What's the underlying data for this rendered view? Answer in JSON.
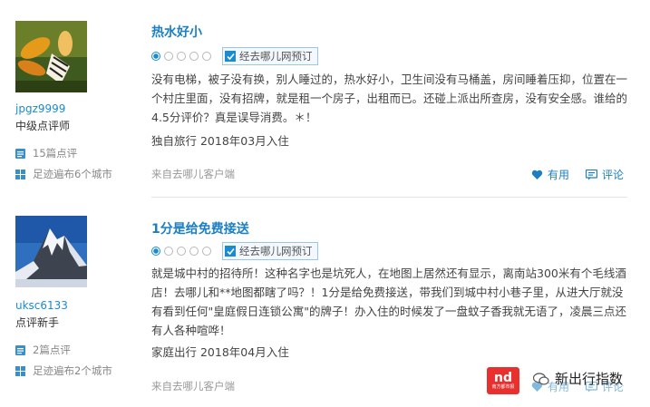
{
  "reviews": [
    {
      "user": {
        "name": "jpgz9999",
        "level": "中级点评师",
        "review_count": "15篇点评",
        "footprint": "足迹遍布6个城市"
      },
      "title": "热水好小",
      "rating": 1,
      "max_rating": 5,
      "verified": "经去哪儿网预订",
      "content": "没有电梯，被子没有换，别人睡过的，热水好小，卫生间没有马桶盖，房间睡着压抑，位置在一个村庄里面，没有招牌，就是租一个房子，出租而已。还碰上派出所查房，没有安全感。谁给的4.5分评价？真是误导消费。＊！",
      "travel": "独自旅行  2018年03月入住",
      "source": "来自去哪儿客户端",
      "useful_label": "有用",
      "comment_label": "评论"
    },
    {
      "user": {
        "name": "uksc6133",
        "level": "点评新手",
        "review_count": "2篇点评",
        "footprint": "足迹遍布2个城市"
      },
      "title": "1分是给免费接送",
      "rating": 1,
      "max_rating": 5,
      "verified": "经去哪儿网预订",
      "content": "就是城中村的招待所！这种名字也是坑死人，在地图上居然还有显示，离南站300米有个毛线酒店！去哪儿和**地图都瞎了吗？！1分是给免费接送，带我们到城中村小巷子里，从进大厅就没有看到任何\"皇庭假日连锁公寓\"的牌子！办入住的时候发了一盘蚊子香我就无语了，凌晨三点还有人各种喧哗！",
      "travel": "家庭出行  2018年04月入住",
      "source": "来自去哪儿客户端",
      "useful_label": "有用",
      "comment_label": "评论"
    }
  ],
  "watermark": {
    "logo": "nd",
    "logo_sub": "南方都市报",
    "text": "新出行指数"
  },
  "colors": {
    "accent": "#1b8bd0",
    "link": "#1b7fc4",
    "watermark_red": "#e8312f"
  }
}
